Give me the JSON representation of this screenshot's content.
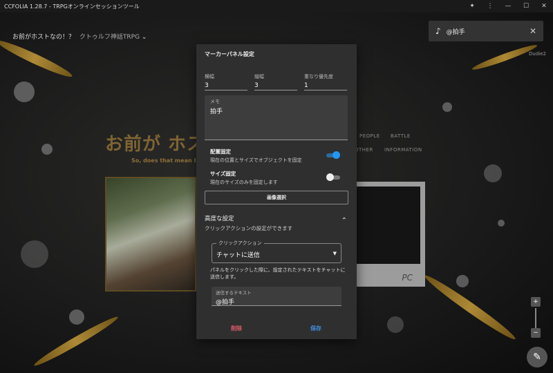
{
  "window": {
    "title": "CCFOLIA 1.28.7 - TRPGオンラインセッションツール",
    "controls": [
      "puzzle",
      "more",
      "minimize",
      "maximize",
      "close"
    ]
  },
  "room": {
    "name": "お前がホストなの！？",
    "system": "クトゥルフ神話TRPG"
  },
  "header_right": "Dudie2",
  "scene": {
    "title": "お前が ホストなの！？",
    "subtitle": "So, does that mean I",
    "menu": [
      "PEOPLE",
      "BATTLE",
      "OTHER",
      "INFORMATION"
    ],
    "polaroid_label": "PC"
  },
  "toast": {
    "icon": "music-note-icon",
    "text": "@拍手"
  },
  "dialog": {
    "title": "マーカーパネル設定",
    "width_label": "横幅",
    "width_value": "3",
    "height_label": "縦幅",
    "height_value": "3",
    "order_label": "重なり優先度",
    "order_value": "1",
    "memo_label": "メモ",
    "memo_value": "拍手",
    "position_lock": {
      "title": "配置固定",
      "desc": "現在の位置とサイズでオブジェクトを固定",
      "on": true
    },
    "size_lock": {
      "title": "サイズ固定",
      "desc": "現在のサイズのみを固定します",
      "on": false
    },
    "image_select": "画像選択",
    "advanced": {
      "title": "高度な設定",
      "desc": "クリックアクションの設定ができます"
    },
    "click_action": {
      "label": "クリックアクション",
      "value": "チャットに送信"
    },
    "help_text": "パネルをクリックした際に、設定されたテキストをチャットに送信します。",
    "send_text": {
      "label": "送信するテキスト",
      "value": "@拍手"
    },
    "delete": "削除",
    "save": "保存"
  },
  "colors": {
    "accent": "#2196f3",
    "danger": "#e05a6a",
    "save": "#3d8fe0",
    "dialog_bg": "#2f2f2f"
  }
}
